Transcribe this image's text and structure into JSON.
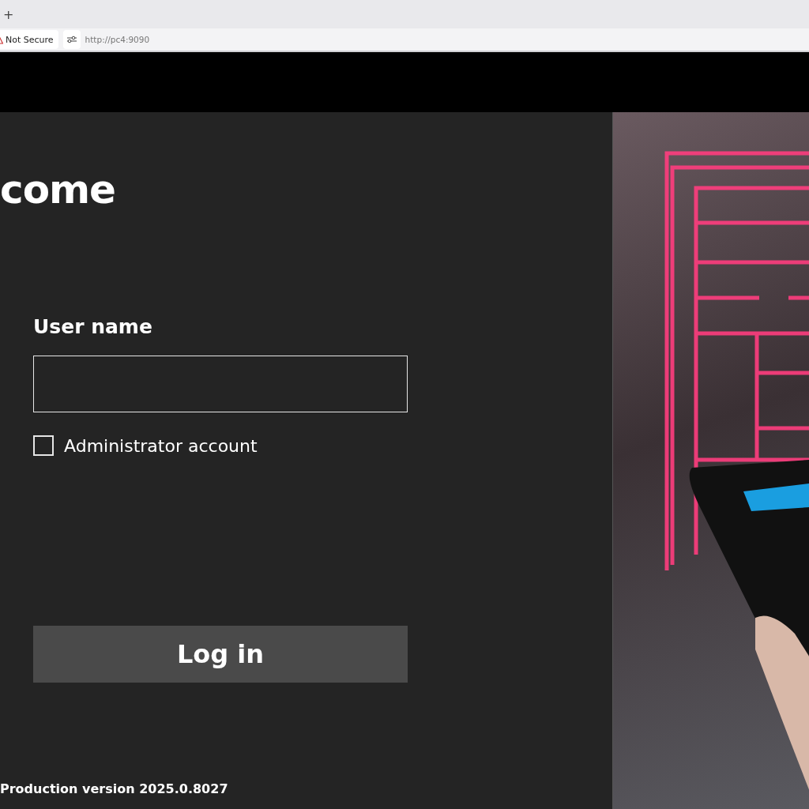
{
  "browser": {
    "new_tab_button": "+",
    "security_label": "Not Secure",
    "url": "http://pc4:9090"
  },
  "login": {
    "heading": "come",
    "username_label": "User name",
    "admin_checkbox": {
      "label": "Administrator account",
      "checked": false
    },
    "login_button": "Log in",
    "version": "Production version 2025.0.8027"
  }
}
